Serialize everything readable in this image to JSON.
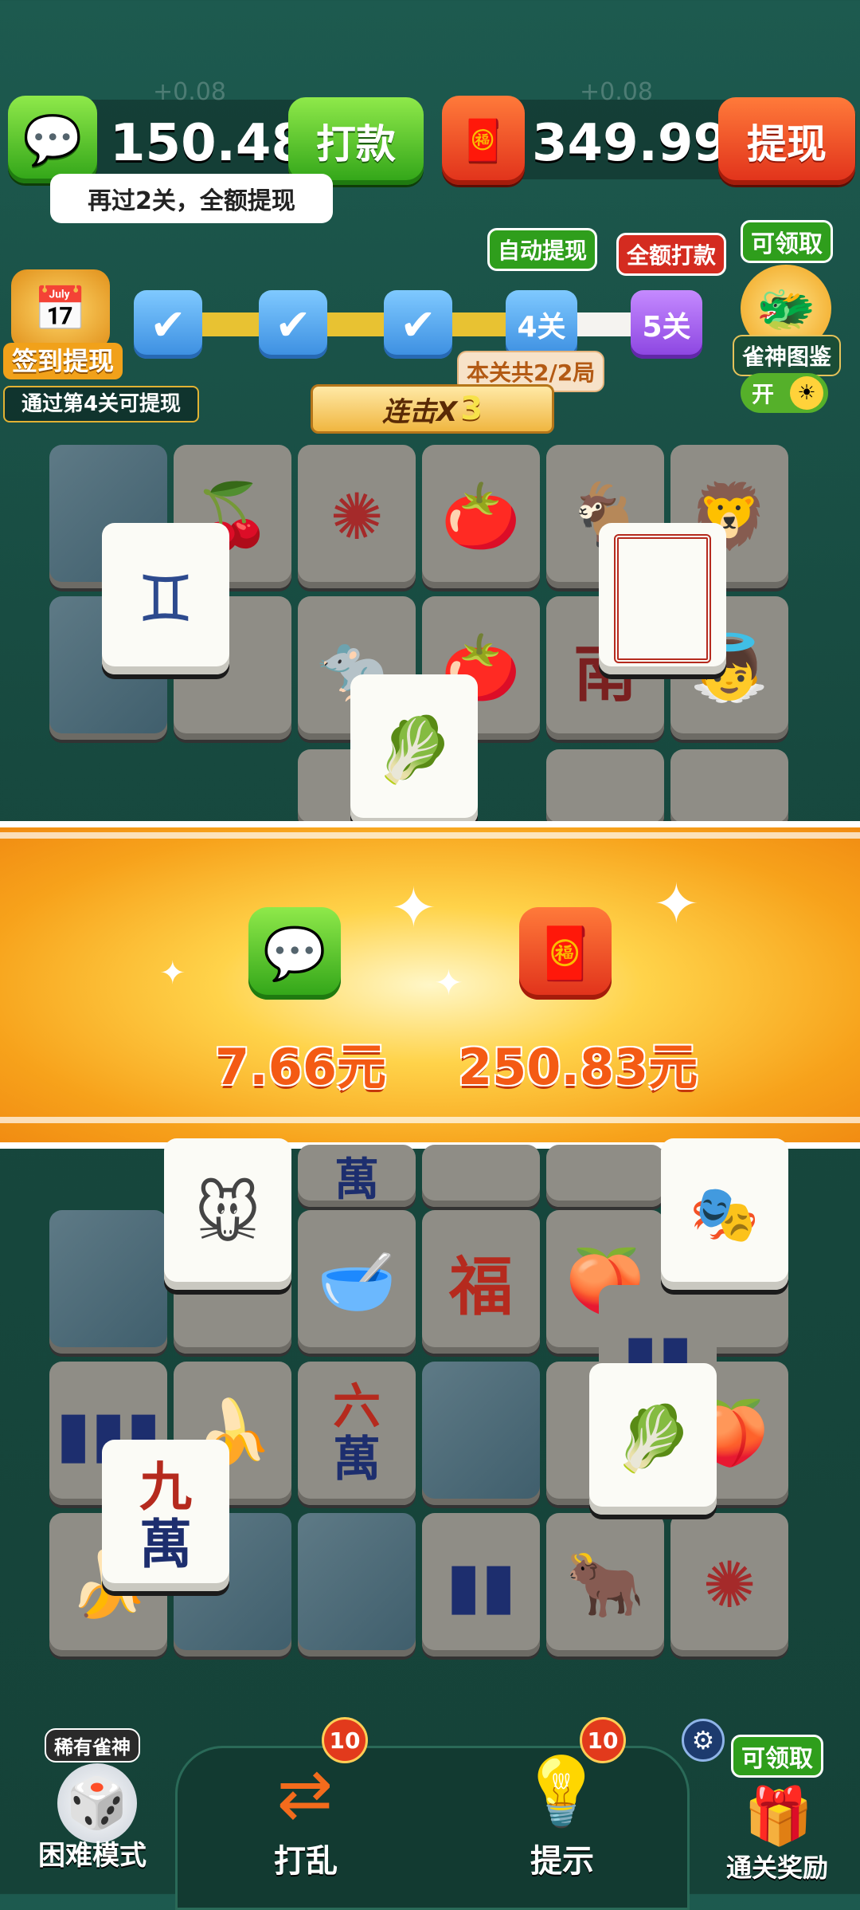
{
  "wallet": {
    "wechat_amount": "150.48",
    "wechat_delta": "+0.08",
    "pay_button": "打款",
    "redpacket_amount": "349.99",
    "redpacket_delta": "+0.08",
    "withdraw_button": "提现",
    "tip": "再过2关，全额提现"
  },
  "progress": {
    "checkin_label": "签到提现",
    "checkin_note": "通过第4关可提现",
    "levels": [
      "4关",
      "5关"
    ],
    "auto_withdraw_flag": "自动提现",
    "full_pay_flag": "全额打款",
    "round_note": "本关共2/2局",
    "claim_label": "可领取",
    "album_label": "雀神图鉴",
    "toggle_label": "开"
  },
  "combo": {
    "label": "连击X",
    "count": "3"
  },
  "banner": {
    "wechat_value": "7.66元",
    "redpacket_value": "250.83元"
  },
  "tiles": {
    "top_twins": "♊",
    "top_frame": "",
    "top_cabbage": "🥬",
    "top_rat": "🐭",
    "top_opera": "三",
    "top_cabbage2": "🥬",
    "top_nine_big": "九",
    "top_nine_small": "萬",
    "fu": "福",
    "six_big": "六",
    "six_small": "萬",
    "wan": "萬",
    "nan": "南"
  },
  "bottom": {
    "rare_label": "稀有雀神",
    "hard_mode": "困难模式",
    "shuffle_label": "打乱",
    "shuffle_count": "10",
    "hint_label": "提示",
    "hint_count": "10",
    "claim_label": "可领取",
    "clear_reward": "通关奖励"
  },
  "colors": {
    "accent_green": "#2fa317",
    "accent_red": "#e0301a",
    "banner_orange": "#f7a21b"
  }
}
